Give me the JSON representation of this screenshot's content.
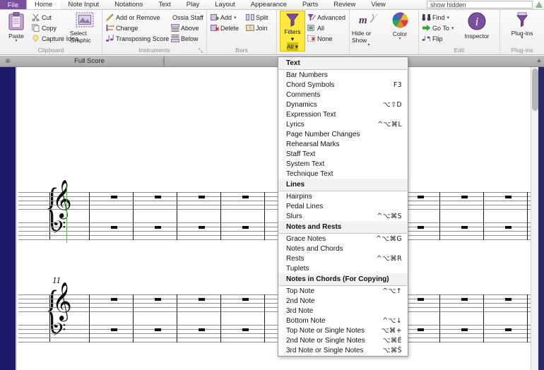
{
  "tabbar": {
    "file": "File",
    "tabs": [
      {
        "label": "Home",
        "active": true
      },
      {
        "label": "Note Input",
        "active": false
      },
      {
        "label": "Notations",
        "active": false
      },
      {
        "label": "Text",
        "active": false
      },
      {
        "label": "Play",
        "active": false
      },
      {
        "label": "Layout",
        "active": false
      },
      {
        "label": "Appearance",
        "active": false
      },
      {
        "label": "Parts",
        "active": false
      },
      {
        "label": "Review",
        "active": false
      },
      {
        "label": "View",
        "active": false
      }
    ],
    "search_value": "show hidden"
  },
  "ribbon": {
    "groups": [
      {
        "label": "Clipboard",
        "big": [
          {
            "label": "Paste",
            "caret": "▾"
          }
        ],
        "small": [
          {
            "label": "Cut",
            "icon": "scissors-icon"
          },
          {
            "label": "Copy",
            "icon": "copy-icon"
          },
          {
            "label": "Capture Idea",
            "icon": "lightbulb-icon"
          }
        ],
        "big2": [
          {
            "label": "Select Graphic",
            "caret": ""
          }
        ]
      },
      {
        "label": "Instruments",
        "small": [
          {
            "label": "Add or Remove",
            "icon": "pencil-icon"
          },
          {
            "label": "Change",
            "icon": "change-icon"
          },
          {
            "label": "Transposing Score",
            "icon": "transpose-icon"
          }
        ],
        "small2": [
          {
            "label": "Ossia Staff",
            "icon": ""
          },
          {
            "label": "Above",
            "icon": "staff-above-icon"
          },
          {
            "label": "Below",
            "icon": "staff-below-icon"
          }
        ],
        "dialog_launcher": "⤡"
      },
      {
        "label": "Bars",
        "small": [
          {
            "label": "Add",
            "icon": "add-bar-icon",
            "caret": "▾"
          },
          {
            "label": "Delete",
            "icon": "delete-bar-icon"
          }
        ],
        "small2": [
          {
            "label": "Split",
            "icon": "split-bar-icon"
          },
          {
            "label": "Join",
            "icon": "join-bar-icon"
          }
        ]
      },
      {
        "label": "",
        "filters": {
          "label": "Filters",
          "caret": "▾",
          "all_label": "All ▾"
        },
        "small": [
          {
            "label": "Advanced",
            "icon": "filter-advanced-icon"
          },
          {
            "label": "All",
            "icon": "select-all-icon"
          },
          {
            "label": "None",
            "icon": "select-none-icon"
          }
        ]
      },
      {
        "label": "",
        "big": [
          {
            "label": "Hide or Show",
            "caret": "▾"
          },
          {
            "label": "Color",
            "caret": "▾"
          }
        ]
      },
      {
        "label": "Edit",
        "small": [
          {
            "label": "Find",
            "icon": "binoculars-icon",
            "caret": "▾"
          },
          {
            "label": "Go To",
            "icon": "arrow-right-icon",
            "caret": "▾"
          },
          {
            "label": "Flip",
            "icon": "flip-icon"
          }
        ],
        "big": [
          {
            "label": "Inspector",
            "caret": ""
          }
        ]
      },
      {
        "label": "Plug-ins",
        "big": [
          {
            "label": "Plug-ins",
            "caret": "▾"
          }
        ]
      }
    ]
  },
  "doctabs": {
    "close_icon": "⊗",
    "tab_label": "Full Score",
    "add_icon": "+"
  },
  "score": {
    "bar_number": "11",
    "treble_clef": "𝄞",
    "bass_clef": "𝄢",
    "brace": "{"
  },
  "menu": {
    "sections": [
      {
        "header": "Text",
        "items": [
          {
            "label": "Bar Numbers",
            "shortcut": ""
          },
          {
            "label": "Chord Symbols",
            "shortcut": "F3"
          },
          {
            "label": "Comments",
            "shortcut": ""
          },
          {
            "label": "Dynamics",
            "shortcut": "⌥⇧D"
          },
          {
            "label": "Expression Text",
            "shortcut": ""
          },
          {
            "label": "Lyrics",
            "shortcut": "^⌥⌘L"
          },
          {
            "label": "Page Number Changes",
            "shortcut": ""
          },
          {
            "label": "Rehearsal Marks",
            "shortcut": ""
          },
          {
            "label": "Staff Text",
            "shortcut": ""
          },
          {
            "label": "System Text",
            "shortcut": ""
          },
          {
            "label": "Technique Text",
            "shortcut": ""
          }
        ]
      },
      {
        "header": "Lines",
        "items": [
          {
            "label": "Hairpins",
            "shortcut": ""
          },
          {
            "label": "Pedal Lines",
            "shortcut": ""
          },
          {
            "label": "Slurs",
            "shortcut": "^⌥⌘S"
          }
        ]
      },
      {
        "header": "Notes and Rests",
        "items": [
          {
            "label": "Grace Notes",
            "shortcut": "^⌥⌘G"
          },
          {
            "label": "Notes and Chords",
            "shortcut": ""
          },
          {
            "label": "Rests",
            "shortcut": "^⌥⌘R"
          },
          {
            "label": "Tuplets",
            "shortcut": ""
          }
        ]
      },
      {
        "header": "Notes in Chords (For Copying)",
        "items": [
          {
            "label": "Top Note",
            "shortcut": "^⌥↑"
          },
          {
            "label": "2nd Note",
            "shortcut": ""
          },
          {
            "label": "3rd Note",
            "shortcut": ""
          },
          {
            "label": "Bottom Note",
            "shortcut": "^⌥↓"
          },
          {
            "label": "Top Note or Single Notes",
            "shortcut": "⌥⌘+"
          },
          {
            "label": "2nd Note or Single Notes",
            "shortcut": "⌥⌘É"
          },
          {
            "label": "3rd Note or Single Notes",
            "shortcut": "⌥⌘Š"
          }
        ]
      }
    ]
  },
  "colors": {
    "accent": "#7b4fa0",
    "filter_highlight": "#ffe93f",
    "page_edge": "#1d1b6b"
  }
}
